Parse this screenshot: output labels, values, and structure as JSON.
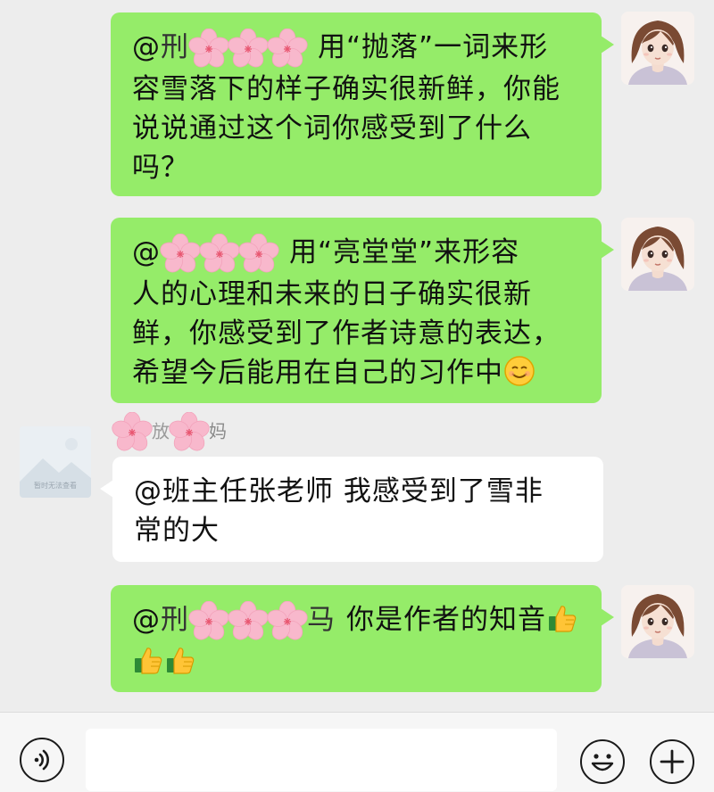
{
  "messages": [
    {
      "side": "right",
      "at": "@",
      "name_visible_fragments": [
        "",
        ""
      ],
      "text_line1": "用“抛落”一词来形",
      "text_rest": [
        "容雪落下的样子确实很新鲜，你能",
        "说说通过这个词你感受到了什么",
        "吗？"
      ]
    },
    {
      "side": "right",
      "at": "@",
      "text_line1": "用“亮堂堂”来形容",
      "text_rest": [
        "人的心理和未来的日子确实很新",
        "鲜，你感受到了作者诗意的表达，",
        "希望今后能用在自己的习作中"
      ],
      "emoji": "smile-emoji"
    },
    {
      "side": "left",
      "sender_visible": "妈",
      "placeholder_caption": "暂时无法查看",
      "text": [
        "@班主任张老师  我感受到了雪非",
        "常的大"
      ]
    },
    {
      "side": "right",
      "at": "@",
      "name_visible_fragments": [
        "",
        ""
      ],
      "text_line1": "你是作者的知音",
      "emoji": "thumbs-up-emoji"
    }
  ],
  "input_bar": {
    "voice_icon": "voice-icon",
    "emoji_icon": "emoji-icon",
    "add_icon": "plus-icon",
    "input_value": ""
  },
  "colors": {
    "background": "#ededed",
    "bubble_self": "#95ec69",
    "bubble_other": "#ffffff",
    "redaction": "#f8b8cc"
  }
}
